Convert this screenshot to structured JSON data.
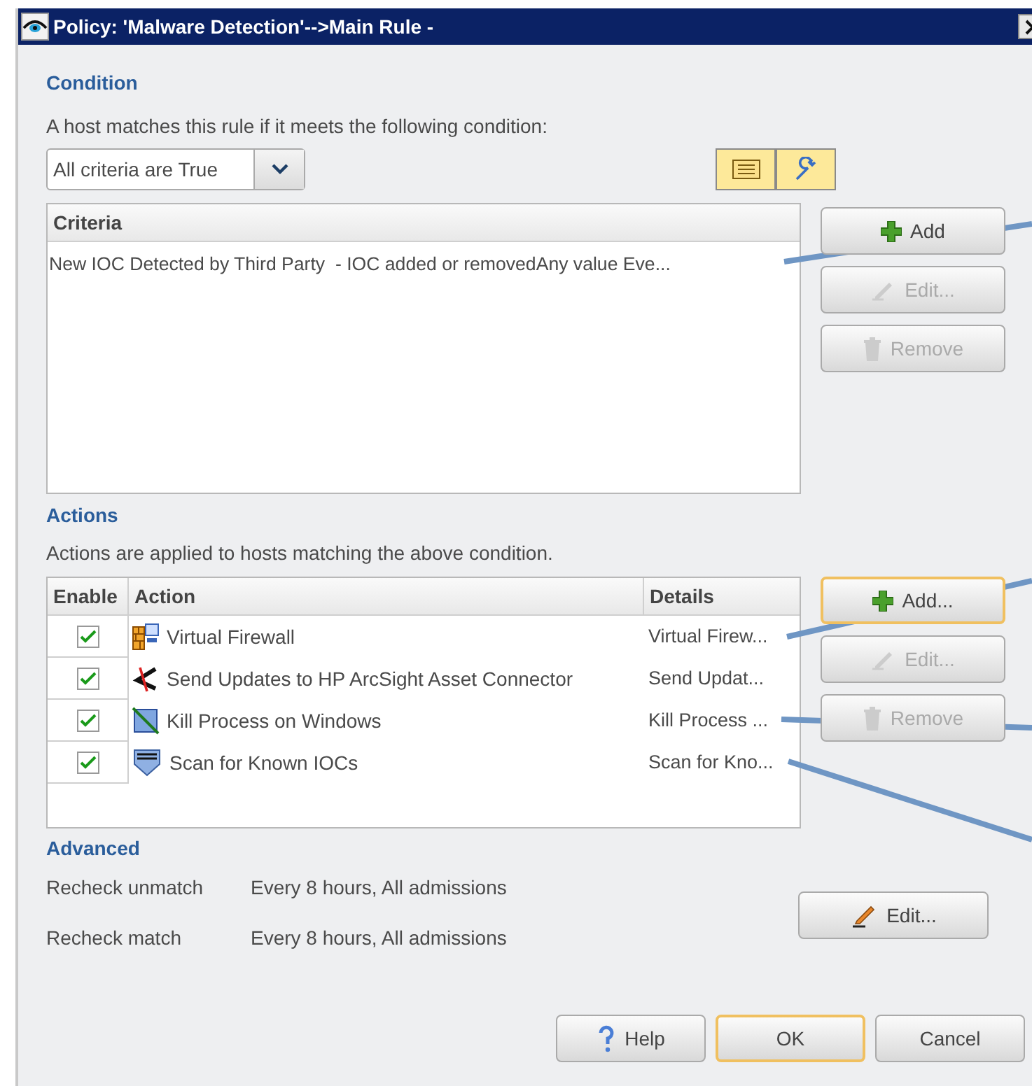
{
  "window": {
    "title": "Policy: 'Malware Detection'-->Main Rule -"
  },
  "condition": {
    "heading": "Condition",
    "description": "A host matches this rule if it meets the following condition:",
    "match_mode": {
      "value": "All criteria are True"
    },
    "view_toggles": [
      {
        "kind": "list"
      },
      {
        "kind": "wrench"
      }
    ],
    "criteria_table": {
      "columns": [
        "Criteria"
      ],
      "rows": [
        "New IOC Detected by Third Party  - IOC added or removedAny value Eve..."
      ]
    },
    "buttons": [
      {
        "kind": "add",
        "label": "Add",
        "disabled": false,
        "focused": false
      },
      {
        "kind": "edit",
        "label": "Edit...",
        "disabled": true,
        "focused": false
      },
      {
        "kind": "remove",
        "label": "Remove",
        "disabled": true,
        "focused": false
      }
    ]
  },
  "actions": {
    "heading": "Actions",
    "description": "Actions are applied to hosts matching the above condition.",
    "table": {
      "columns": [
        "Enable",
        "Action",
        "Details"
      ],
      "rows": [
        {
          "enabled": true,
          "kind": "firewall",
          "action": "Virtual Firewall",
          "details": "Virtual Firew..."
        },
        {
          "enabled": true,
          "kind": "connector",
          "action": "Send Updates to HP ArcSight Asset Connector",
          "details": "Send Updat..."
        },
        {
          "enabled": true,
          "kind": "kill",
          "action": "Kill Process on Windows",
          "details": "Kill Process ..."
        },
        {
          "enabled": true,
          "kind": "scan",
          "action": "Scan for Known IOCs",
          "details": "Scan for Kno..."
        }
      ]
    },
    "buttons": [
      {
        "kind": "add",
        "label": "Add...",
        "disabled": false,
        "focused": true
      },
      {
        "kind": "edit",
        "label": "Edit...",
        "disabled": true,
        "focused": false
      },
      {
        "kind": "remove",
        "label": "Remove",
        "disabled": true,
        "focused": false
      }
    ]
  },
  "advanced": {
    "heading": "Advanced",
    "settings": [
      {
        "label": "Recheck unmatch",
        "value": "Every 8 hours, All admissions"
      },
      {
        "label": "Recheck match",
        "value": "Every 8 hours, All admissions"
      }
    ],
    "button": {
      "kind": "pencil",
      "label": "Edit...",
      "disabled": false,
      "focused": false
    }
  },
  "footer_buttons": [
    {
      "kind": "help",
      "label": "Help",
      "disabled": false,
      "focused": false
    },
    {
      "kind": "plain",
      "label": "OK",
      "disabled": false,
      "focused": true
    },
    {
      "kind": "plain",
      "label": "Cancel",
      "disabled": false,
      "focused": false
    }
  ]
}
